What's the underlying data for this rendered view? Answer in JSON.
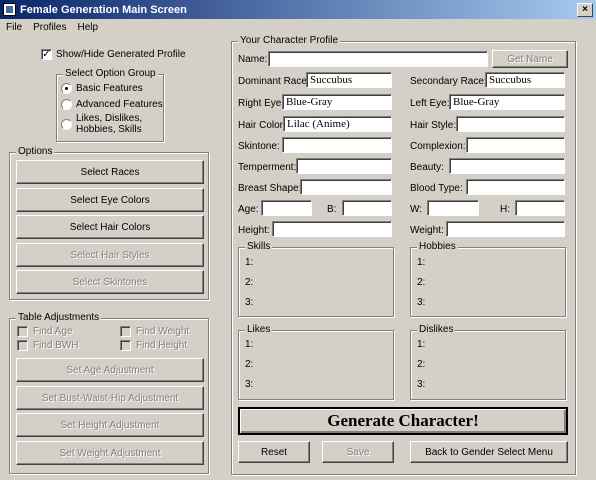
{
  "window": {
    "title": "Female Generation Main Screen",
    "close_glyph": "×"
  },
  "menu": {
    "file": "File",
    "profiles": "Profiles",
    "help": "Help"
  },
  "left": {
    "show_hide_label": "Show/Hide Generated Profile",
    "show_hide_checked": "✓",
    "option_group": {
      "title": "Select Option Group",
      "basic": "Basic Features",
      "advanced": "Advanced Features",
      "likes": "Likes, Dislikes, Hobbies, Skills"
    },
    "options": {
      "title": "Options",
      "races": "Select Races",
      "eye_colors": "Select Eye Colors",
      "hair_colors": "Select Hair Colors",
      "hair_styles": "Select Hair Styles",
      "skintones": "Select Skintones"
    },
    "table_adjust": {
      "title": "Table Adjustments",
      "find_age": "Find Age",
      "find_weight": "Find Weight",
      "find_bwh": "Find BWH",
      "find_height": "Find Height",
      "set_age": "Set Age Adjustment",
      "set_bwh": "Set Bust-Waist-Hip Adjustment",
      "set_height": "Set Height Adjustment",
      "set_weight": "Set Weight Adjustment"
    }
  },
  "profile": {
    "title": "Your Character Profile",
    "name_label": "Name:",
    "name_value": "",
    "get_name": "Get Name",
    "dominant_race_label": "Dominant Race:",
    "dominant_race_value": "Succubus",
    "secondary_race_label": "Secondary Race:",
    "secondary_race_value": "Succubus",
    "right_eye_label": "Right Eye:",
    "right_eye_value": "Blue-Gray",
    "left_eye_label": "Left Eye:",
    "left_eye_value": "Blue-Gray",
    "hair_color_label": "Hair Color:",
    "hair_color_value": "Lilac (Anime)",
    "hair_style_label": "Hair Style:",
    "hair_style_value": "",
    "skintone_label": "Skintone:",
    "skintone_value": "",
    "complexion_label": "Complexion:",
    "complexion_value": "",
    "temperment_label": "Temperment:",
    "temperment_value": "",
    "beauty_label": "Beauty:",
    "beauty_value": "",
    "breast_shape_label": "Breast Shape:",
    "breast_shape_value": "",
    "blood_type_label": "Blood Type:",
    "blood_type_value": "",
    "age_label": "Age:",
    "b_label": "B:",
    "w_label": "W:",
    "h_label": "H:",
    "height_label": "Height:",
    "weight_label": "Weight:",
    "skills_title": "Skills",
    "hobbies_title": "Hobbies",
    "likes_title": "Likes",
    "dislikes_title": "Dislikes",
    "n1": "1:",
    "n2": "2:",
    "n3": "3:",
    "generate": "Generate Character!",
    "reset": "Reset",
    "save": "Save",
    "back": "Back to Gender Select Menu"
  }
}
